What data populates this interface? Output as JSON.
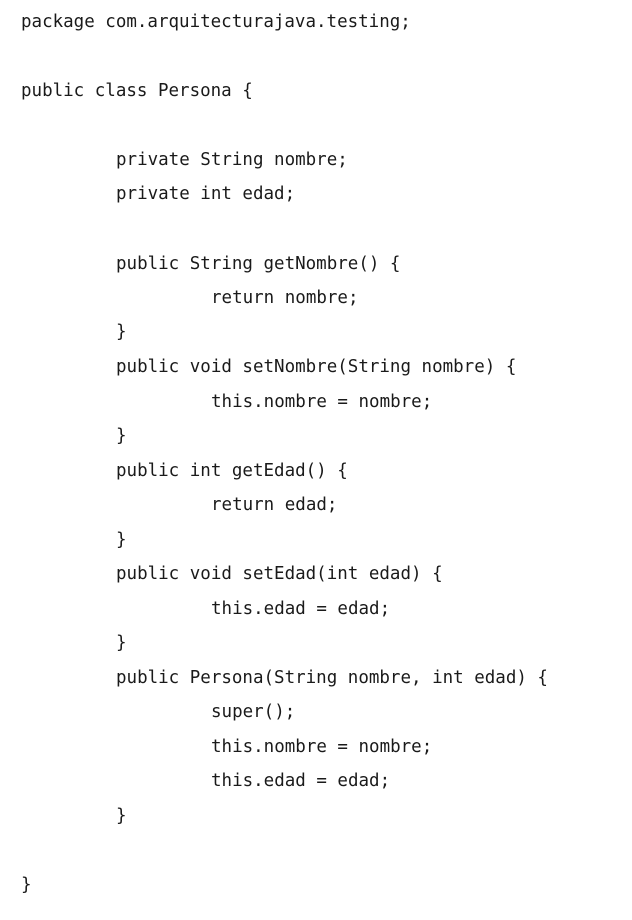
{
  "code": {
    "lines": [
      "package com.arquitecturajava.testing;",
      "public class Persona {",
      "private String nombre;",
      "private int edad;",
      "public String getNombre() {",
      "return nombre;",
      "}",
      "public void setNombre(String nombre) {",
      "this.nombre = nombre;",
      "}",
      "public int getEdad() {",
      "return edad;",
      "}",
      "public void setEdad(int edad) {",
      "this.edad = edad;",
      "}",
      "public Persona(String nombre, int edad) {",
      "super();",
      "this.nombre = nombre;",
      "this.edad = edad;",
      "}",
      "}"
    ]
  }
}
